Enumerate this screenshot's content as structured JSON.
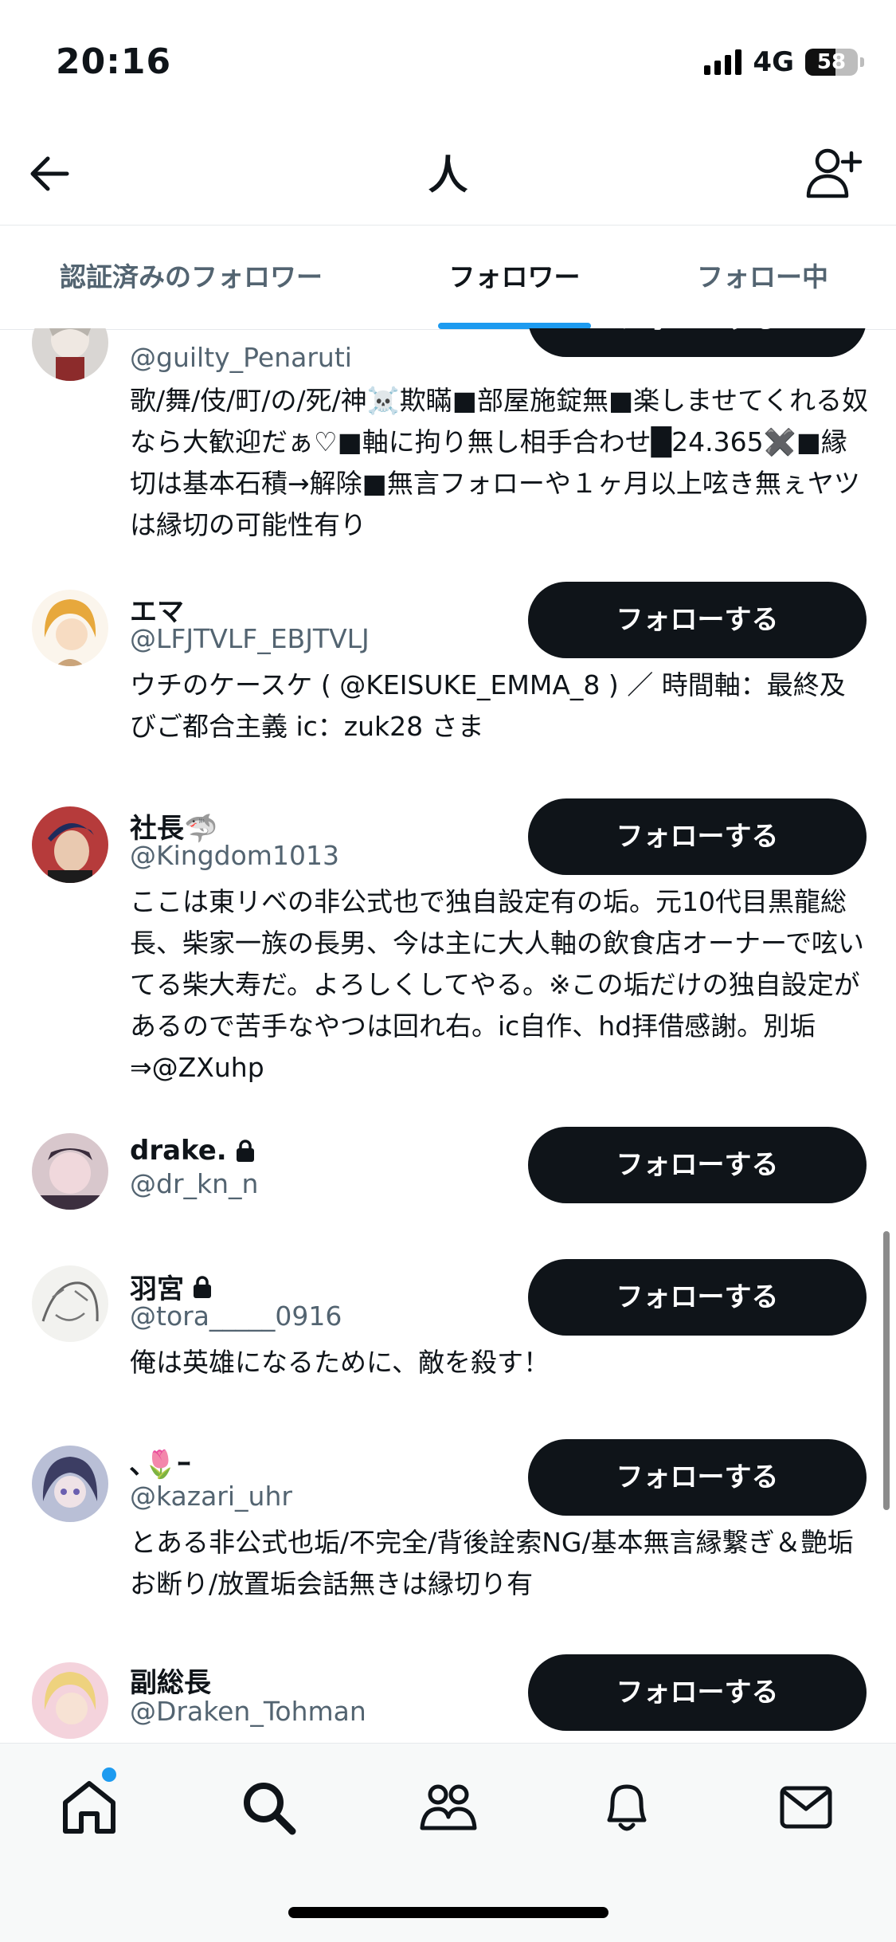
{
  "status_bar": {
    "time": "20:16",
    "network": "4G",
    "battery": "58",
    "battery_level": 0.58
  },
  "header": {
    "title": "人"
  },
  "tabs": [
    {
      "label": "認証済みのフォロワー"
    },
    {
      "label": "フォロワー"
    },
    {
      "label": "フォロー中"
    }
  ],
  "users": [
    {
      "name": "",
      "handle": "@guilty_Penaruti",
      "bio": "歌/舞/伎/町/の/死/神☠️欺瞞■部屋施錠無■楽しませてくれる奴なら大歓迎だぁ♡■軸に拘り無し相手合わせ█24.365✖️■縁切は基本石積→解除■無言フォローや１ヶ月以上呟き無ぇヤツは縁切の可能性有り",
      "follow_label": "フォローする"
    },
    {
      "name": "エマ",
      "handle": "@LFJTVLF_EBJTVLJ",
      "bio": "ウチのケースケ ( @KEISUKE_EMMA_8 ) ／ 時間軸：最終及びご都合主義 ic：zuk28 さま",
      "follow_label": "フォローする"
    },
    {
      "name": "社長🦈",
      "handle": "@Kingdom1013",
      "bio": "ここは東リベの非公式也で独自設定有の垢。元10代目黒龍総長、柴家一族の長男、今は主に大人軸の飲食店オーナーで呟いてる柴大寿だ。よろしくしてやる。※この垢だけの独自設定があるので苦手なやつは回れ右。ic自作、hd拝借感謝。別垢⇒@ZXuhp",
      "follow_label": "フォローする"
    },
    {
      "name": "drake.",
      "handle": "@dr_kn_n",
      "bio": "",
      "follow_label": "フォローする"
    },
    {
      "name": "羽宮",
      "handle": "@tora_____0916",
      "bio": "俺は英雄になるために、敵を殺す！",
      "follow_label": "フォローする"
    },
    {
      "name": "､🌷ｰ",
      "handle": "@kazari_uhr",
      "bio": "とある非公式也垢/不完全/背後詮索NG/基本無言縁繋ぎ＆艶垢お断り/放置垢会話無きは縁切り有",
      "follow_label": "フォローする"
    },
    {
      "name": "副総長",
      "handle": "@Draken_Tohman",
      "bio": "",
      "follow_label": "フォローする"
    }
  ],
  "nav": [
    "home-icon",
    "search-icon",
    "communities-icon",
    "notifications-icon",
    "messages-icon"
  ],
  "colors": {
    "accent": "#1d9bf0",
    "button": "#0f1419",
    "secondary_text": "#536471"
  }
}
